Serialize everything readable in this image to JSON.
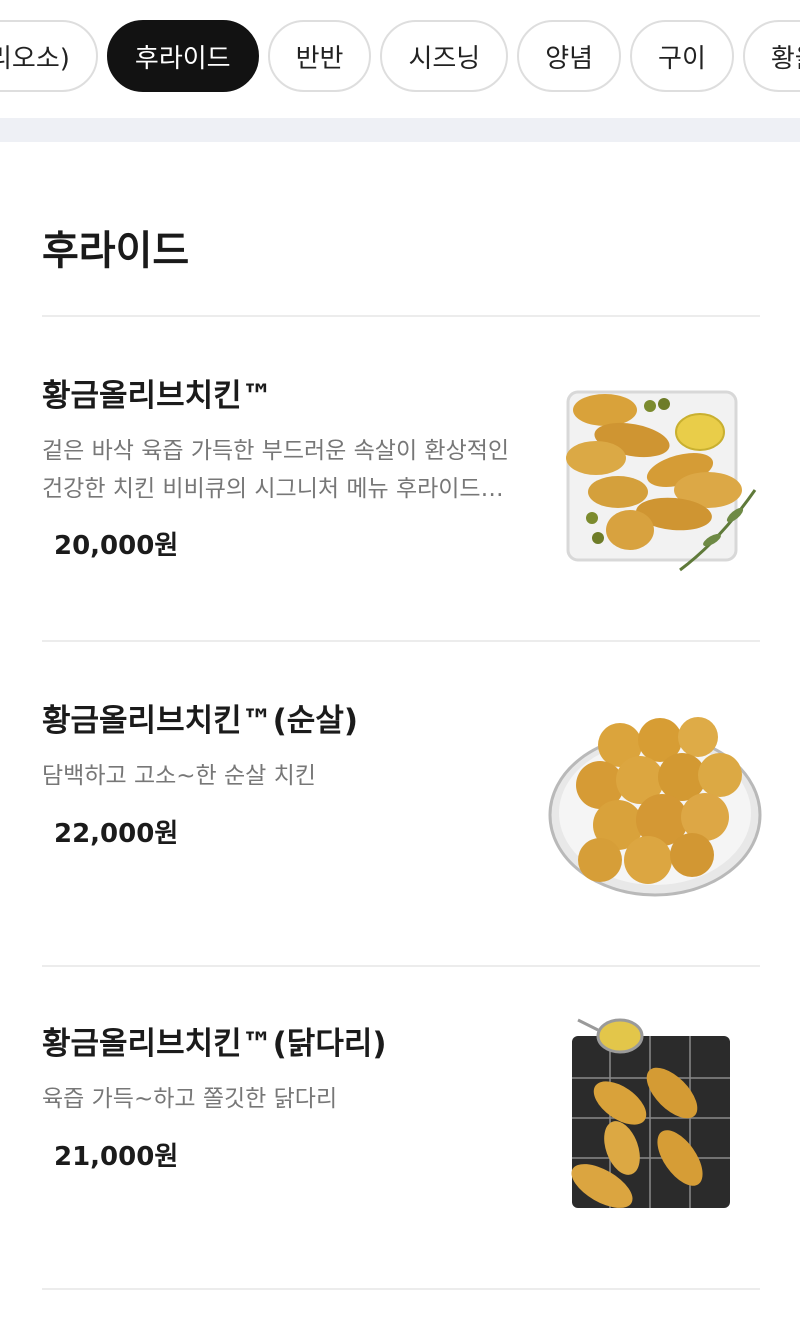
{
  "tabs": [
    {
      "label": "리오소)",
      "active": false
    },
    {
      "label": "후라이드",
      "active": true
    },
    {
      "label": "반반",
      "active": false
    },
    {
      "label": "시즈닝",
      "active": false
    },
    {
      "label": "양념",
      "active": false
    },
    {
      "label": "구이",
      "active": false
    },
    {
      "label": "황올",
      "active": false
    }
  ],
  "section_title": "후라이드",
  "items": [
    {
      "name": "황금올리브치킨™",
      "desc_lines": [
        "겉은 바삭 육즙 가득한 부드러운 속살이 환상적인",
        "건강한 치킨 비비큐의 시그니처 메뉴 후라이드…"
      ],
      "price": "20,000원"
    },
    {
      "name": "황금올리브치킨™(순살)",
      "desc_lines": [
        "담백하고 고소~한 순살 치킨"
      ],
      "price": "22,000원"
    },
    {
      "name": "황금올리브치킨™(닭다리)",
      "desc_lines": [
        "육즙 가득~하고 쫄깃한 닭다리"
      ],
      "price": "21,000원"
    }
  ],
  "colors": {
    "active_tab_bg": "#121212",
    "band": "#eef0f5",
    "chicken": "#d9a23a"
  }
}
